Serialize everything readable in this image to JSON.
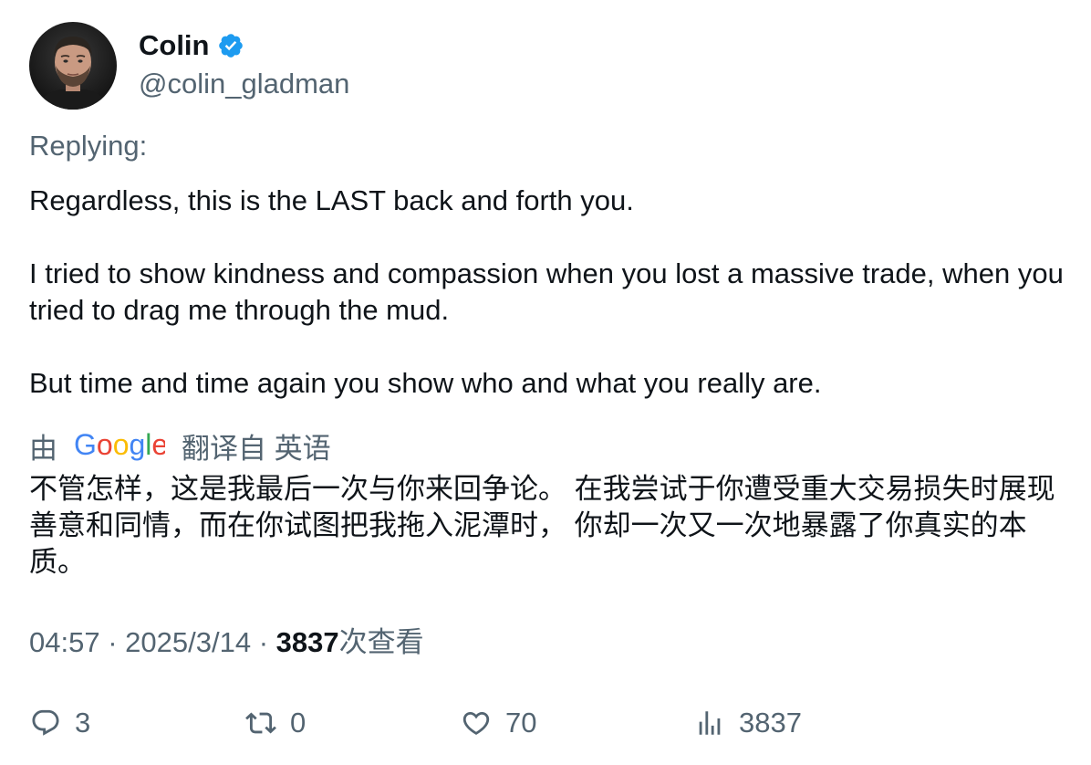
{
  "user": {
    "display_name": "Colin",
    "handle": "@colin_gladman",
    "verified": true
  },
  "tweet": {
    "replying_label": "Replying:",
    "paragraphs": [
      "Regardless, this is the LAST back and forth you.",
      "I tried to show kindness and compassion when you lost a massive trade, when you tried to drag me through the mud.",
      "But time and time again you show who and what you really are."
    ]
  },
  "translation": {
    "prefix": "由",
    "provider": "Google",
    "suffix": "翻译自 英语",
    "text": "不管怎样，这是我最后一次与你来回争论。 在我尝试于你遭受重大交易损失时展现善意和同情，而在你试图把我拖入泥潭时， 你却一次又一次地暴露了你真实的本质。"
  },
  "meta": {
    "time": "04:57",
    "separator": "·",
    "date": "2025/3/14",
    "views_count": "3837",
    "views_label": "次查看"
  },
  "actions": {
    "reply_count": "3",
    "retweet_count": "0",
    "like_count": "70",
    "views_count": "3837"
  },
  "colors": {
    "verified_blue": "#1d9bf0",
    "secondary_text": "#536471",
    "primary_text": "#0f1419"
  },
  "icons": {
    "verified": "verified-badge-icon",
    "reply": "reply-icon",
    "retweet": "retweet-icon",
    "like": "heart-icon",
    "views": "views-chart-icon"
  }
}
